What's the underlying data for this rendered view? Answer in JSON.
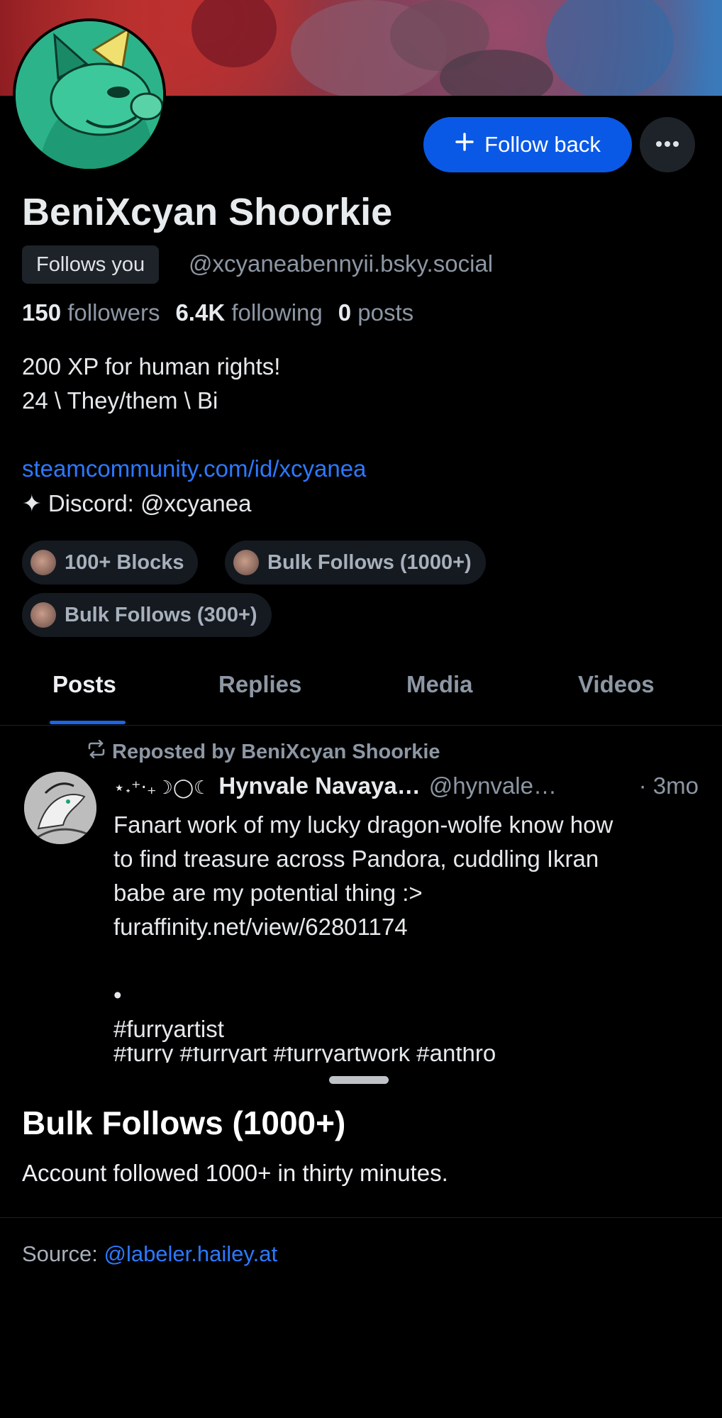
{
  "profile": {
    "name": "BeniXcyan Shoorkie",
    "follows_you": "Follows you",
    "handle": "@xcyaneabennyii.bsky.social",
    "stats": {
      "followers_count": "150",
      "followers_label": "followers",
      "following_count": "6.4K",
      "following_label": "following",
      "posts_count": "0",
      "posts_label": "posts"
    },
    "bio": {
      "line1": "200 XP for human rights!",
      "line2": "24 \\ They/them \\ Bi",
      "link": "steamcommunity.com/id/xcyanea",
      "discord": "✦ Discord: @xcyanea"
    },
    "actions": {
      "follow_back": "Follow back",
      "follow_icon": "plus-icon",
      "more_icon": "ellipsis-icon"
    },
    "labels": [
      {
        "text": "100+ Blocks"
      },
      {
        "text": "Bulk Follows (1000+)"
      },
      {
        "text": "Bulk Follows (300+)"
      }
    ]
  },
  "tabs": [
    "Posts",
    "Replies",
    "Media",
    "Videos"
  ],
  "active_tab": "Posts",
  "post": {
    "repost_label": "Reposted by BeniXcyan Shoorkie",
    "author_decor": "⋆˖⁺‧₊☽◯☾",
    "author_name": "Hynvale Navaya…",
    "author_handle": "@hynvale…",
    "time": "· 3mo",
    "text_lines": [
      "Fanart work of my lucky dragon-wolfe know how",
      "to find treasure across Pandora, cuddling Ikran",
      "babe are my potential thing :>"
    ],
    "link": "furaffinity.net/view/62801174",
    "dot": "•",
    "hashtag": "#furryartist",
    "hashtag_cut": "#furry #furryart #furryartwork #anthro"
  },
  "sheet": {
    "title": "Bulk Follows (1000+)",
    "description": "Account followed 1000+ in thirty minutes.",
    "source_label": "Source:",
    "source_link": "@labeler.hailey.at"
  },
  "colors": {
    "accent": "#0a59e6",
    "link": "#2c79ff",
    "muted": "#8d97a4",
    "background": "#000000"
  }
}
